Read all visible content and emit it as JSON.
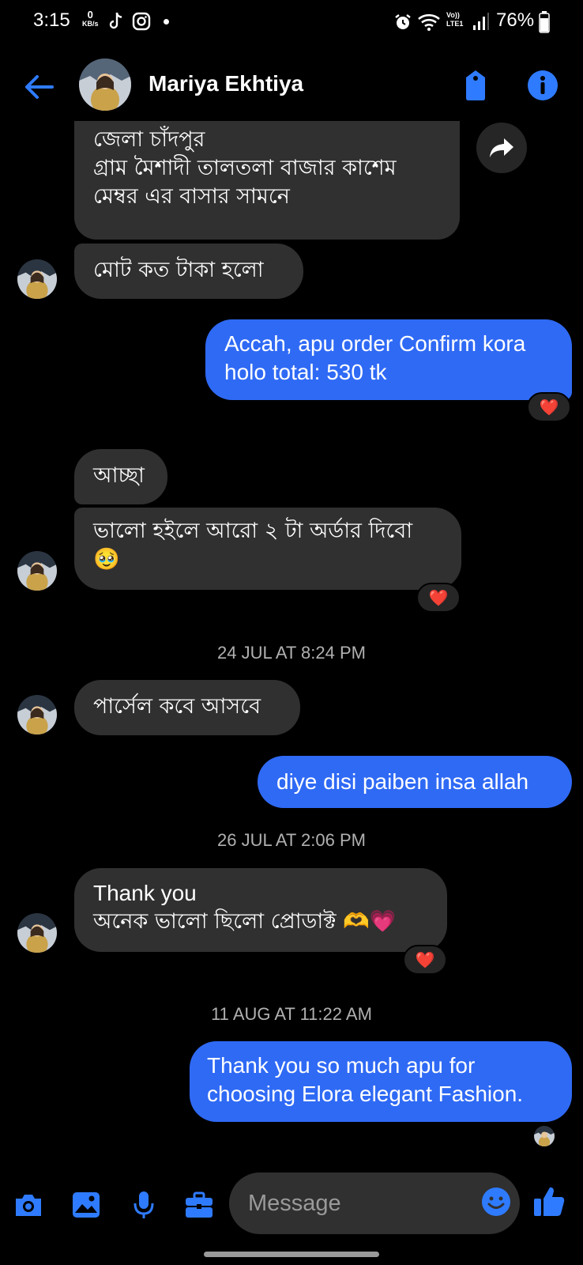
{
  "status_bar": {
    "time": "3:15",
    "net_speed_value": "0",
    "net_speed_unit": "KB/s",
    "lte_top": "Vo))",
    "lte_bottom": "LTE1",
    "battery": "76%"
  },
  "header": {
    "contact_name": "Mariya Ekhtiya"
  },
  "messages": {
    "m1": {
      "lines": [
        "জেলা চাঁদপুর",
        "গ্রাম মৈশাদী তালতলা বাজার কাশেম",
        "মেম্বর এর বাসার সামনে"
      ]
    },
    "m2": {
      "text": "মোট কত টাকা হলো"
    },
    "m3": {
      "lines": [
        "Accah, apu order Confirm kora",
        "holo total: 530 tk"
      ]
    },
    "m4": {
      "text": "আচ্ছা"
    },
    "m5": {
      "lines": [
        "ভালো হইলে আরো ২ টা অর্ডার দিবো",
        "🥹"
      ]
    },
    "m6": {
      "text": "পার্সেল কবে আসবে"
    },
    "m7": {
      "text": "diye disi paiben insa allah"
    },
    "m8": {
      "lines": [
        "Thank you",
        "অনেক ভালো ছিলো প্রোডাক্ট 🫶💗"
      ]
    },
    "m9": {
      "lines": [
        "Thank you so much apu for",
        "choosing Elora elegant Fashion."
      ]
    }
  },
  "timestamps": {
    "t1": "24 JUL AT 8:24 PM",
    "t2": "26 JUL AT 2:06 PM",
    "t3": "11 AUG AT 11:22 AM"
  },
  "reactions": {
    "heart": "❤️"
  },
  "composer": {
    "placeholder": "Message"
  },
  "colors": {
    "accent": "#2f6af5",
    "incoming_bubble": "#303030",
    "icon_blue": "#1f7bff",
    "background": "#000000"
  }
}
